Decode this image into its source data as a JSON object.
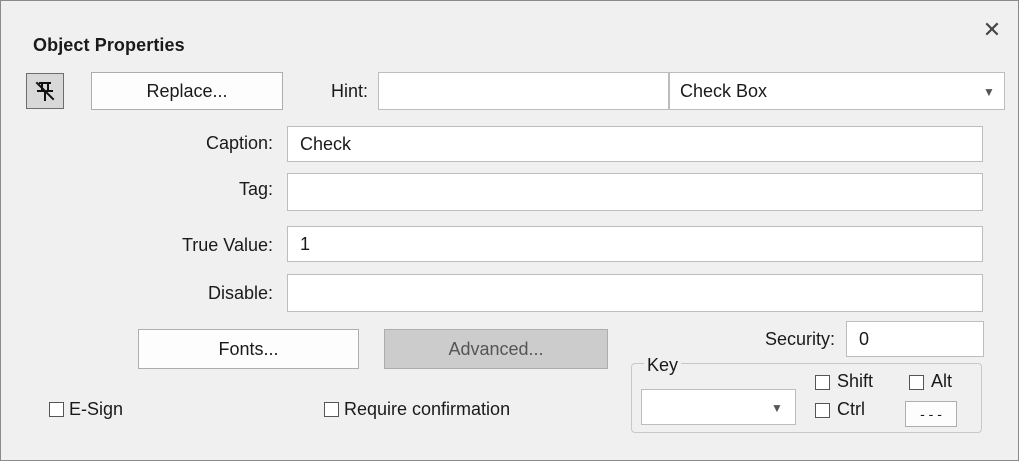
{
  "dialog": {
    "title": "Object Properties",
    "close_glyph": "✕"
  },
  "toolbar": {
    "pin_icon": "pin-off-icon",
    "replace_label": "Replace...",
    "hint_label": "Hint:",
    "hint_value": "",
    "object_type_value": "Check Box"
  },
  "fields": {
    "caption_label": "Caption:",
    "caption_value": "Check",
    "tag_label": "Tag:",
    "tag_value": "",
    "true_value_label": "True Value:",
    "true_value_value": "1",
    "disable_label": "Disable:",
    "disable_value": ""
  },
  "buttons": {
    "fonts_label": "Fonts...",
    "advanced_label": "Advanced..."
  },
  "security": {
    "label": "Security:",
    "value": "0"
  },
  "key": {
    "group_label": "Key",
    "key_value": "",
    "shift_label": "Shift",
    "shift_checked": false,
    "alt_label": "Alt",
    "alt_checked": false,
    "ctrl_label": "Ctrl",
    "ctrl_checked": false,
    "browse_label": "- - -"
  },
  "options": {
    "esign_label": "E-Sign",
    "esign_checked": false,
    "require_confirmation_label": "Require confirmation",
    "require_confirmation_checked": false
  },
  "colors": {
    "background": "#f0f0f0",
    "disabled_button": "#cccccc",
    "input_border": "#bdbdbd"
  }
}
